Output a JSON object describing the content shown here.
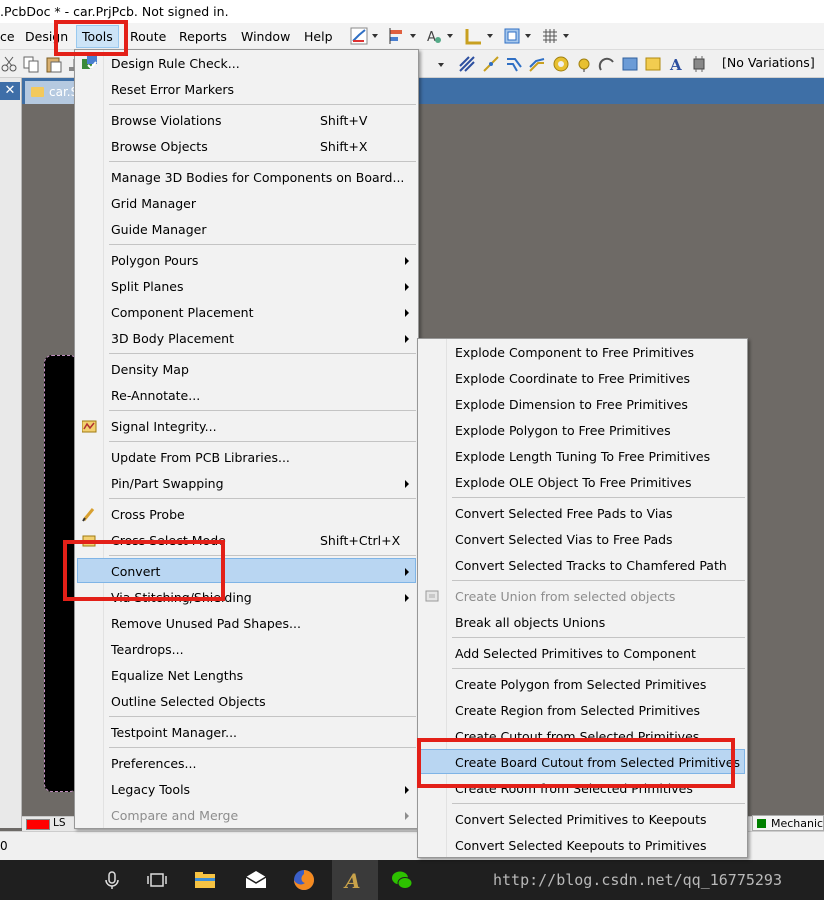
{
  "window": {
    "title": ".PcbDoc * - car.PrjPcb. Not signed in."
  },
  "menubar": {
    "items": [
      "ce",
      "Design",
      "Tools",
      "Route",
      "Reports",
      "Window",
      "Help"
    ]
  },
  "toolbar": {
    "variations": "[No Variations]"
  },
  "document": {
    "tab": "car.S"
  },
  "layers": {
    "left_label": "LS",
    "right_label": "Mechanica"
  },
  "statusbar": {
    "text": "0"
  },
  "tools_menu": {
    "items": [
      {
        "label": "Design Rule Check...",
        "shortcut": "",
        "submenu": false,
        "disabled": false
      },
      {
        "label": "Reset Error Markers",
        "shortcut": "",
        "submenu": false,
        "disabled": false
      },
      {
        "label": "Browse Violations",
        "shortcut": "Shift+V",
        "submenu": false,
        "disabled": false
      },
      {
        "label": "Browse Objects",
        "shortcut": "Shift+X",
        "submenu": false,
        "disabled": false
      },
      {
        "label": "Manage 3D Bodies for Components on Board...",
        "shortcut": "",
        "submenu": false,
        "disabled": false
      },
      {
        "label": "Grid Manager",
        "shortcut": "",
        "submenu": false,
        "disabled": false
      },
      {
        "label": "Guide Manager",
        "shortcut": "",
        "submenu": false,
        "disabled": false
      },
      {
        "label": "Polygon Pours",
        "shortcut": "",
        "submenu": true,
        "disabled": false
      },
      {
        "label": "Split Planes",
        "shortcut": "",
        "submenu": true,
        "disabled": false
      },
      {
        "label": "Component Placement",
        "shortcut": "",
        "submenu": true,
        "disabled": false
      },
      {
        "label": "3D Body Placement",
        "shortcut": "",
        "submenu": true,
        "disabled": false
      },
      {
        "label": "Density Map",
        "shortcut": "",
        "submenu": false,
        "disabled": false
      },
      {
        "label": "Re-Annotate...",
        "shortcut": "",
        "submenu": false,
        "disabled": false
      },
      {
        "label": "Signal Integrity...",
        "shortcut": "",
        "submenu": false,
        "disabled": false
      },
      {
        "label": "Update From PCB Libraries...",
        "shortcut": "",
        "submenu": false,
        "disabled": false
      },
      {
        "label": "Pin/Part Swapping",
        "shortcut": "",
        "submenu": true,
        "disabled": false
      },
      {
        "label": "Cross Probe",
        "shortcut": "",
        "submenu": false,
        "disabled": false
      },
      {
        "label": "Cross Select Mode",
        "shortcut": "Shift+Ctrl+X",
        "submenu": false,
        "disabled": false
      },
      {
        "label": "Convert",
        "shortcut": "",
        "submenu": true,
        "disabled": false
      },
      {
        "label": "Via Stitching/Shielding",
        "shortcut": "",
        "submenu": true,
        "disabled": false
      },
      {
        "label": "Remove Unused Pad Shapes...",
        "shortcut": "",
        "submenu": false,
        "disabled": false
      },
      {
        "label": "Teardrops...",
        "shortcut": "",
        "submenu": false,
        "disabled": false
      },
      {
        "label": "Equalize Net Lengths",
        "shortcut": "",
        "submenu": false,
        "disabled": false
      },
      {
        "label": "Outline Selected Objects",
        "shortcut": "",
        "submenu": false,
        "disabled": false
      },
      {
        "label": "Testpoint Manager...",
        "shortcut": "",
        "submenu": false,
        "disabled": false
      },
      {
        "label": "Preferences...",
        "shortcut": "",
        "submenu": false,
        "disabled": false
      },
      {
        "label": "Legacy Tools",
        "shortcut": "",
        "submenu": true,
        "disabled": false
      },
      {
        "label": "Compare and Merge",
        "shortcut": "",
        "submenu": true,
        "disabled": true
      }
    ]
  },
  "convert_menu": {
    "items": [
      {
        "label": "Explode Component to Free Primitives",
        "disabled": false
      },
      {
        "label": "Explode Coordinate to Free Primitives",
        "disabled": false
      },
      {
        "label": "Explode Dimension to Free Primitives",
        "disabled": false
      },
      {
        "label": "Explode Polygon to Free Primitives",
        "disabled": false
      },
      {
        "label": "Explode Length Tuning To Free Primitives",
        "disabled": false
      },
      {
        "label": "Explode OLE Object To Free Primitives",
        "disabled": false
      },
      {
        "label": "Convert Selected Free Pads to Vias",
        "disabled": false
      },
      {
        "label": "Convert Selected Vias to Free Pads",
        "disabled": false
      },
      {
        "label": "Convert Selected Tracks to Chamfered Path",
        "disabled": false
      },
      {
        "label": "Create Union from selected objects",
        "disabled": true
      },
      {
        "label": "Break all objects Unions",
        "disabled": false
      },
      {
        "label": "Add Selected Primitives to Component",
        "disabled": false
      },
      {
        "label": "Create Polygon from Selected Primitives",
        "disabled": false
      },
      {
        "label": "Create Region from Selected Primitives",
        "disabled": false
      },
      {
        "label": "Create Cutout from Selected Primitives",
        "disabled": false
      },
      {
        "label": "Create Board Cutout from Selected Primitives",
        "disabled": false
      },
      {
        "label": "Create Room from Selected Primitives",
        "disabled": false
      },
      {
        "label": "Convert Selected Primitives to Keepouts",
        "disabled": false
      },
      {
        "label": "Convert Selected Keepouts to Primitives",
        "disabled": false
      }
    ]
  },
  "watermark": "http://blog.csdn.net/qq_16775293",
  "icons": [
    "drc-icon",
    "signal-integrity-icon",
    "cross-probe-icon",
    "cross-select-icon",
    "union-icon",
    "microphone-icon",
    "task-view-icon",
    "file-explorer-icon",
    "mail-icon",
    "firefox-icon",
    "altium-icon",
    "wechat-icon"
  ],
  "colors": {
    "highlight": "#b9d6f2",
    "annotation_red": "#e32018",
    "tab_strip": "#3e6fa6",
    "canvas": "#6e6a66"
  }
}
